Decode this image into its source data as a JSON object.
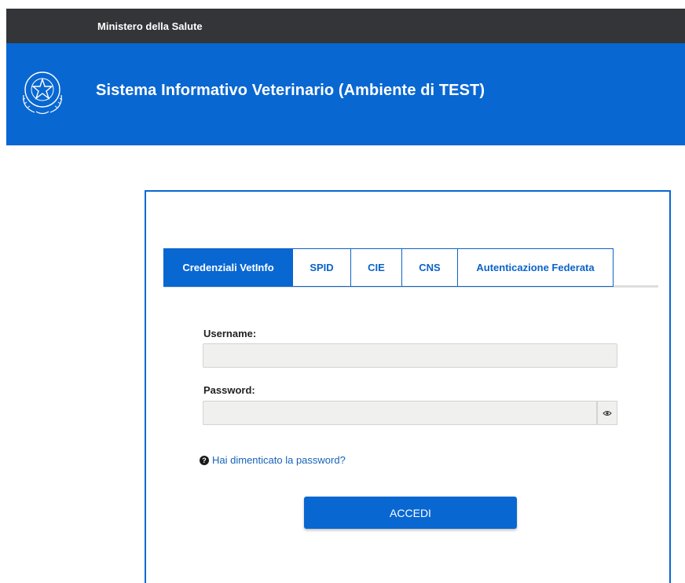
{
  "topbar": {
    "ministry": "Ministero della Salute"
  },
  "header": {
    "title": "Sistema Informativo Veterinario (Ambiente di TEST)",
    "emblem_icon": "italian-republic-emblem"
  },
  "colors": {
    "brand_blue": "#0967d2",
    "topbar_dark": "#333538"
  },
  "tabs": [
    {
      "label": "Credenziali VetInfo",
      "active": true
    },
    {
      "label": "SPID",
      "active": false
    },
    {
      "label": "CIE",
      "active": false
    },
    {
      "label": "CNS",
      "active": false
    },
    {
      "label": "Autenticazione Federata",
      "active": false
    }
  ],
  "form": {
    "username_label": "Username:",
    "username_value": "",
    "password_label": "Password:",
    "password_value": "",
    "show_password_icon": "eye-icon",
    "forgot_icon": "question-circle-icon",
    "forgot_label": "Hai dimenticato la password?",
    "submit_label": "ACCEDI"
  }
}
